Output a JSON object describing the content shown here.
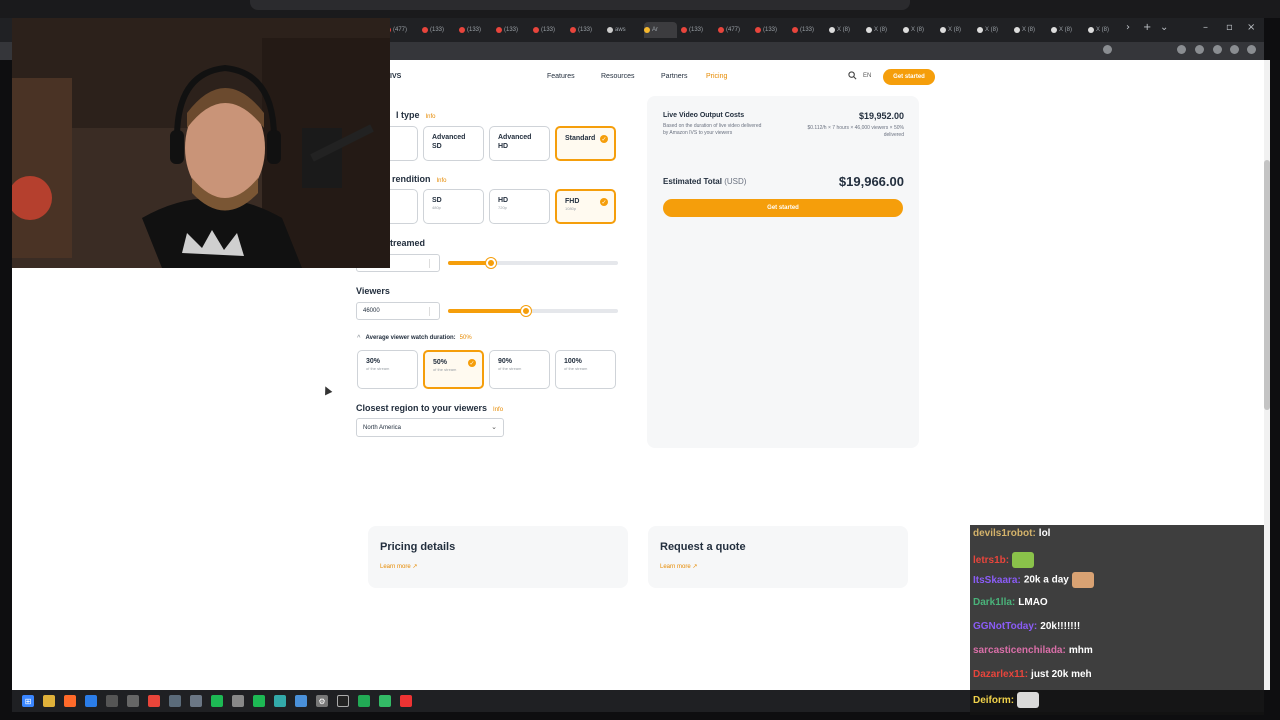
{
  "browser": {
    "tabs": [
      "(477)",
      "(133)",
      "(133)",
      "(133)",
      "(133)",
      "(133)",
      "aws",
      "Ar",
      "(133)",
      "(477)",
      "(133)",
      "(133)",
      "X (8)",
      "X (8)",
      "X (8)",
      "X (8)",
      "X (8)",
      "X (8)",
      "X (8)",
      "X (8)"
    ],
    "new_tab": "+",
    "tab_list": "⌄"
  },
  "site": {
    "logo": "IVS",
    "nav": [
      "Features",
      "Resources",
      "Partners",
      "Pricing"
    ],
    "lang": "EN",
    "cta": "Get started"
  },
  "calculator": {
    "channel_type": {
      "label": "l type",
      "info": "Info",
      "options": [
        {
          "title": "",
          "sub": ""
        },
        {
          "title": "Advanced SD",
          "sub": ""
        },
        {
          "title": "Advanced HD",
          "sub": ""
        },
        {
          "title": "Standard",
          "sub": "",
          "selected": true
        }
      ]
    },
    "rendition": {
      "label": "rendition",
      "info": "Info",
      "options": [
        {
          "title": "",
          "sub": ""
        },
        {
          "title": "SD",
          "sub": "480p"
        },
        {
          "title": "HD",
          "sub": "720p"
        },
        {
          "title": "FHD",
          "sub": "1080p",
          "selected": true
        }
      ]
    },
    "hours": {
      "label": "treamed",
      "value": "",
      "fill_fraction": 0.25
    },
    "viewers": {
      "label": "Viewers",
      "value": "46000",
      "fill_fraction": 0.46
    },
    "watch_duration": {
      "label": "Average viewer watch duration:",
      "value": "50%",
      "options": [
        {
          "title": "30%",
          "sub": "of the stream"
        },
        {
          "title": "50%",
          "sub": "of the stream",
          "selected": true
        },
        {
          "title": "90%",
          "sub": "of the stream"
        },
        {
          "title": "100%",
          "sub": "of the stream"
        }
      ]
    },
    "region": {
      "label": "Closest region to your viewers",
      "info": "Info",
      "value": "North America"
    }
  },
  "summary": {
    "title": "Live Video Output Costs",
    "desc": "Based on the duration of live video delivered by Amazon IVS to your viewers",
    "amount": "$19,952.00",
    "formula": "$0.112/h × 7 hours × 46,000 viewers × 50% delivered",
    "total_label": "Estimated Total",
    "total_currency": "(USD)",
    "total_value": "$19,966.00",
    "cta": "Get started"
  },
  "cards": [
    {
      "title": "Pricing details",
      "link": "Learn more ↗"
    },
    {
      "title": "Request a quote",
      "link": "Learn more ↗"
    }
  ],
  "chat": [
    {
      "user": "devils1robot:",
      "color": "#d4b36a",
      "text": "lol"
    },
    {
      "user": "letrs1b:",
      "color": "#e8453c",
      "text": "",
      "emote": "#8ac24a"
    },
    {
      "user": "ItsSkaara:",
      "color": "#8a5cf6",
      "text": "20k a day",
      "emote_after": "#d9a273"
    },
    {
      "user": "Dark1lla:",
      "color": "#4ab37a",
      "text": "LMAO"
    },
    {
      "user": "GGNotToday:",
      "color": "#8a5cf6",
      "text": "20k!!!!!!!"
    },
    {
      "user": "sarcasticenchilada:",
      "color": "#d96fa8",
      "text": "mhm"
    },
    {
      "user": "Dazarlex11:",
      "color": "#e8453c",
      "text": "just 20k meh"
    },
    {
      "user": "Deiform:",
      "color": "#f0d24a",
      "text": "",
      "emote": "#d9d9d9"
    }
  ],
  "colors": {
    "accent": "#f59e0b",
    "text": "#232f3e"
  }
}
